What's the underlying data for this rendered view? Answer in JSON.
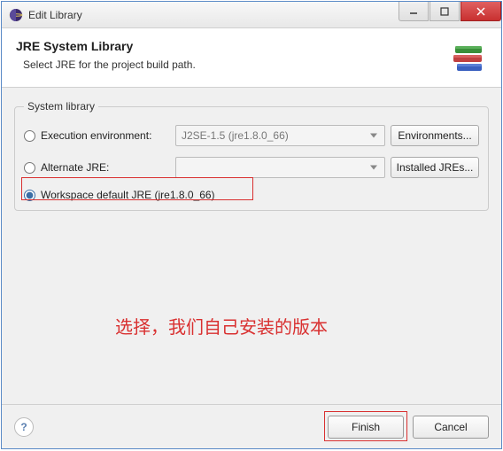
{
  "window": {
    "title": "Edit Library"
  },
  "header": {
    "title": "JRE System Library",
    "subtitle": "Select JRE for the project build path."
  },
  "fieldset": {
    "legend": "System library"
  },
  "radios": {
    "exec_env": {
      "label": "Execution environment:",
      "value": "J2SE-1.5 (jre1.8.0_66)"
    },
    "alt_jre": {
      "label": "Alternate JRE:",
      "value": ""
    },
    "workspace": {
      "label": "Workspace default JRE (jre1.8.0_66)"
    }
  },
  "buttons": {
    "environments": "Environments...",
    "installed": "Installed JREs...",
    "finish": "Finish",
    "cancel": "Cancel"
  },
  "annotation": "选择，我们自己安装的版本"
}
